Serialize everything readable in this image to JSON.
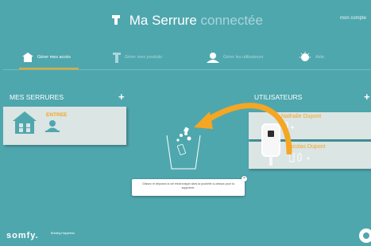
{
  "header": {
    "title_bold": "Ma Serrure",
    "title_light": "connectée",
    "account": "mon compte"
  },
  "nav": [
    {
      "label": "Gérer mes accès",
      "icon": "house-icon"
    },
    {
      "label": "Gérer mes produits",
      "icon": "lock-icon"
    },
    {
      "label": "Gérer les utilisateurs",
      "icon": "user-icon"
    },
    {
      "label": "Aide",
      "icon": "lightbulb-icon"
    }
  ],
  "locks": {
    "title": "MES SERRURES",
    "items": [
      {
        "name": "ENTREE"
      }
    ]
  },
  "users": {
    "title": "UTILISATEURS",
    "items": [
      {
        "name": "Nathalie Dupont"
      },
      {
        "name": "Nicolas Dupont"
      }
    ]
  },
  "toast": {
    "message": "Glissez et déposez la clé électronique dans la poubelle ci-dessus pour la supprimer."
  },
  "brand": {
    "name": "somfy.",
    "tagline": "Building Happiness"
  },
  "colors": {
    "background": "#4fa7ae",
    "accent": "#f5a623",
    "panel": "#dbe5e4"
  }
}
